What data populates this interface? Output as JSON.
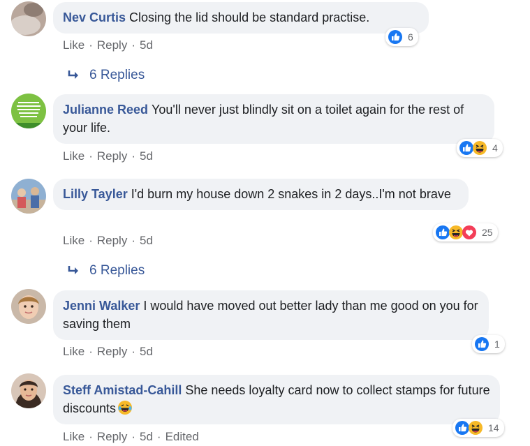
{
  "labels": {
    "like": "Like",
    "reply": "Reply",
    "dot": "·"
  },
  "colors": {
    "link": "#385898",
    "bubble": "#f0f2f5",
    "meta": "#65676b",
    "like_blue": "#1877f2",
    "haha_yellow": "#f7b928",
    "love_red": "#f33e58"
  },
  "comments": [
    {
      "author": "Nev Curtis",
      "text": "Closing the lid should be standard practise.",
      "time": "5d",
      "reaction_icons": [
        "like-icon"
      ],
      "reaction_count": "6",
      "replies": "6 Replies"
    },
    {
      "author": "Julianne Reed",
      "text": "You'll never just blindly sit on a toilet again for the rest of your life.",
      "time": "5d",
      "reaction_icons": [
        "like-icon",
        "haha-icon"
      ],
      "reaction_count": "4"
    },
    {
      "author": "Lilly Tayler",
      "text": "I'd burn my house down 2 snakes in 2 days..I'm not brave",
      "time": "5d",
      "reaction_icons": [
        "like-icon",
        "haha-icon",
        "love-icon"
      ],
      "reaction_count": "25",
      "replies": "6 Replies"
    },
    {
      "author": "Jenni Walker",
      "text": "I would have moved out better lady than me good on you for saving them",
      "time": "5d",
      "reaction_icons": [
        "like-icon"
      ],
      "reaction_count": "1"
    },
    {
      "author": "Steff Amistad-Cahill",
      "text": "She needs loyalty card now to collect stamps for future discounts",
      "text_emoji": "laughing-tears-emoji",
      "time": "5d",
      "edited": "Edited",
      "reaction_icons": [
        "like-icon",
        "haha-icon"
      ],
      "reaction_count": "14"
    }
  ]
}
